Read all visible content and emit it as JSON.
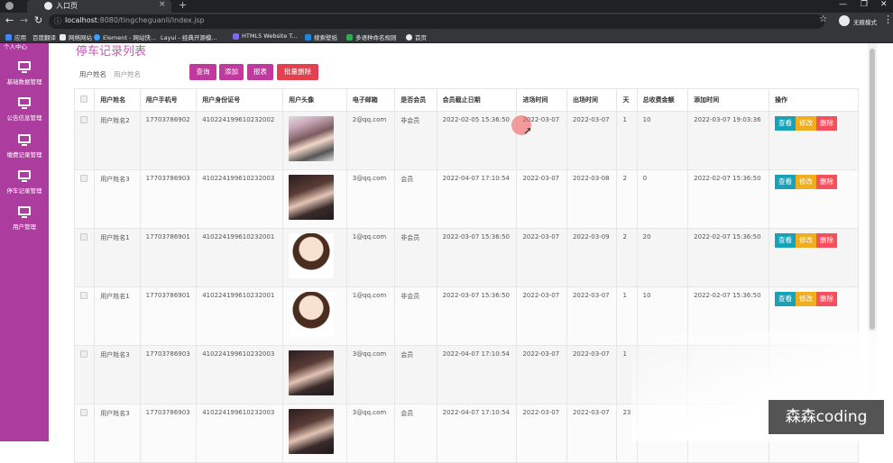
{
  "browser": {
    "tab_title": "入口页",
    "tab_close": "×",
    "new_tab": "+",
    "window_controls": [
      "—",
      "❐",
      "✕"
    ],
    "url_host": "localhost",
    "url_rest": ":8080/tingcheguanli/index.jsp",
    "profile_label": "无痕模式",
    "bookmarks": [
      "应用",
      "百度翻译",
      "网络网站",
      "Element - 网站快...",
      "Layui - 经典开源模...",
      "HTML5 Website T...",
      "搜索壁纸",
      "多语种命名规则",
      "首页"
    ]
  },
  "sidebar": {
    "top_label": "个人中心",
    "items": [
      {
        "label": "基础数据管理",
        "icon": "monitor-icon"
      },
      {
        "label": "公告信息管理",
        "icon": "monitor-icon"
      },
      {
        "label": "缴费记录管理",
        "icon": "monitor-icon"
      },
      {
        "label": "停车记录管理",
        "icon": "monitor-icon"
      },
      {
        "label": "用户管理",
        "icon": "monitor-icon"
      }
    ]
  },
  "main": {
    "title": "停车记录列表",
    "search_label": "用户姓名",
    "search_placeholder": "用户姓名",
    "buttons": {
      "query": "查询",
      "add": "添加",
      "report": "报表",
      "batch_delete": "批量删除"
    },
    "table": {
      "headers": [
        "用户姓名",
        "用户手机号",
        "用户身份证号",
        "用户头像",
        "电子邮箱",
        "是否会员",
        "会员截止日期",
        "进场时间",
        "出场时间",
        "天",
        "总收费金额",
        "添加时间",
        "操作"
      ],
      "actions": {
        "view": "查看",
        "edit": "修改",
        "delete": "删除"
      },
      "rows": [
        {
          "name": "用户姓名2",
          "phone": "17703786902",
          "id_card": "410224199610232002",
          "avatar": "pillow",
          "email": "2@qq.com",
          "member": "非会员",
          "member_until": "2022-02-05 15:36:50",
          "enter": "2022-03-07",
          "exit": "2022-03-07",
          "days": "1",
          "fee": "10",
          "added": "2022-03-07 19:03:36",
          "has_actions": true
        },
        {
          "name": "用户姓名3",
          "phone": "17703786903",
          "id_card": "410224199610232003",
          "avatar": "dark",
          "email": "3@qq.com",
          "member": "会员",
          "member_until": "2022-04-07 17:10:54",
          "enter": "2022-03-07",
          "exit": "2022-03-08",
          "days": "2",
          "fee": "0",
          "added": "2022-02-07 15:36:50",
          "has_actions": true
        },
        {
          "name": "用户姓名1",
          "phone": "17703786901",
          "id_card": "410224199610232001",
          "avatar": "cartoon",
          "email": "1@qq.com",
          "member": "非会员",
          "member_until": "2022-03-07 15:36:50",
          "enter": "2022-03-07",
          "exit": "2022-03-09",
          "days": "2",
          "fee": "20",
          "added": "2022-02-07 15:36:50",
          "has_actions": true
        },
        {
          "name": "用户姓名1",
          "phone": "17703786901",
          "id_card": "410224199610232001",
          "avatar": "cartoon",
          "email": "1@qq.com",
          "member": "非会员",
          "member_until": "2022-03-07 15:36:50",
          "enter": "2022-03-07",
          "exit": "2022-03-07",
          "days": "1",
          "fee": "10",
          "added": "2022-02-07 15:36:50",
          "has_actions": true
        },
        {
          "name": "用户姓名3",
          "phone": "17703786903",
          "id_card": "410224199610232003",
          "avatar": "dark",
          "email": "3@qq.com",
          "member": "会员",
          "member_until": "2022-04-07 17:10:54",
          "enter": "2022-03-07",
          "exit": "2022-03-07",
          "days": "1",
          "fee": "",
          "added": "",
          "has_actions": false
        },
        {
          "name": "用户姓名3",
          "phone": "17703786903",
          "id_card": "410224199610232003",
          "avatar": "dark",
          "email": "3@qq.com",
          "member": "会员",
          "member_until": "2022-04-07 17:10:54",
          "enter": "2022-03-07",
          "exit": "2022-03-07",
          "days": "23",
          "fee": "",
          "added": "",
          "has_actions": false
        }
      ]
    }
  },
  "watermark": "森森coding",
  "colors": {
    "sidebar": "#ad3c9f",
    "title": "#c158b5",
    "query": "#c0399f",
    "add": "#c0399f",
    "report": "#c0399f",
    "batch_delete": "#e4404f",
    "view": "#17a2b8",
    "edit": "#f0ad1e",
    "delete": "#f4505d"
  }
}
